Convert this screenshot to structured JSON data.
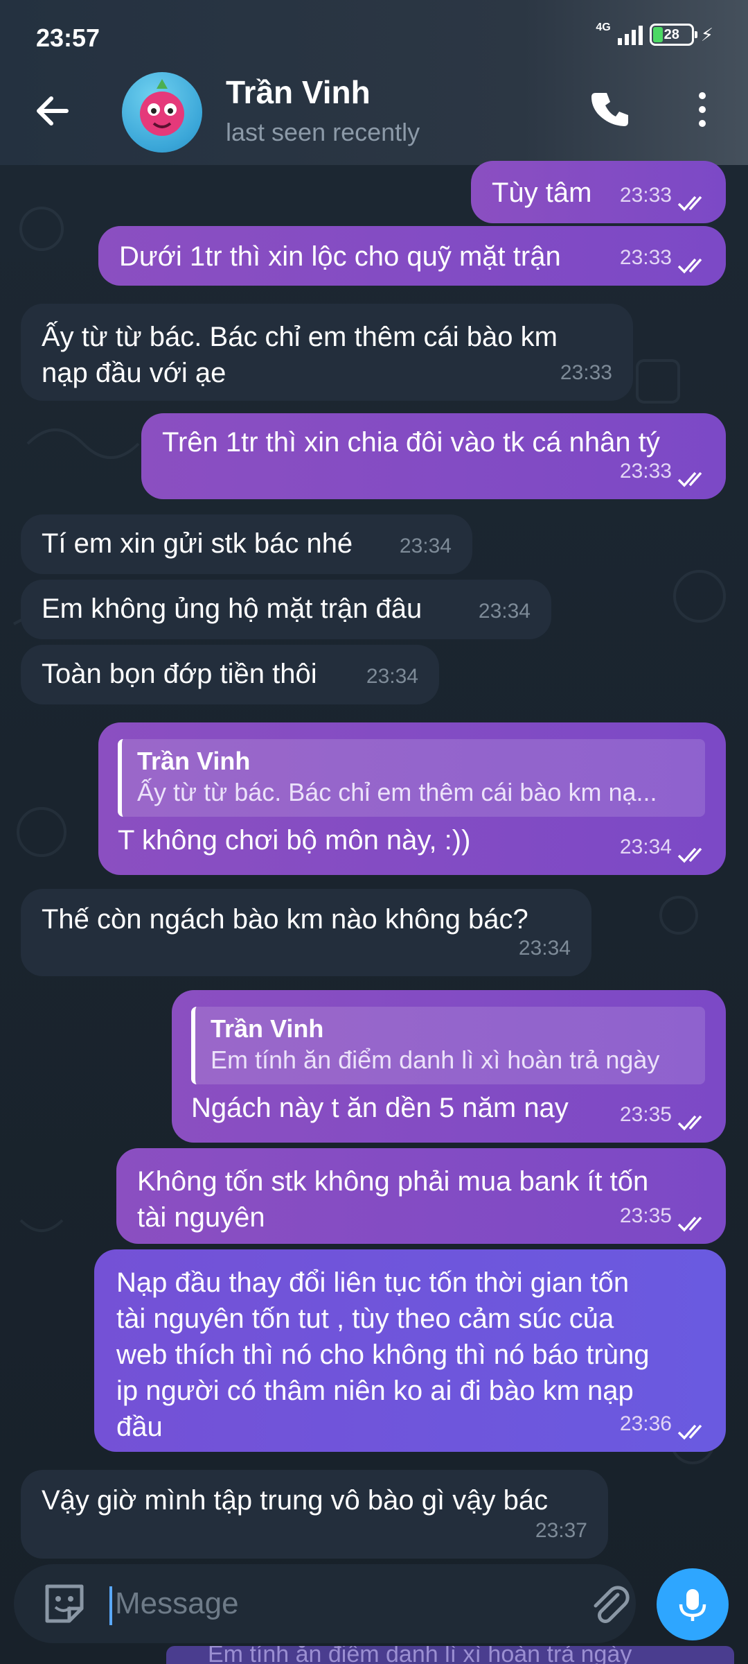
{
  "status_bar": {
    "time": "23:57",
    "network": "4G",
    "battery": "28"
  },
  "header": {
    "title": "Trần Vinh",
    "subtitle": "last seen recently"
  },
  "messages": [
    {
      "dir": "out",
      "text": "Tùy tâm",
      "time": "23:33"
    },
    {
      "dir": "out",
      "text": "Dưới 1tr thì xin lộc cho quỹ mặt trận",
      "time": "23:33"
    },
    {
      "dir": "in",
      "line1": "Ấy từ từ bác. Bác chỉ em thêm cái bào km",
      "line2": "nạp đầu với ạe",
      "time": "23:33"
    },
    {
      "dir": "out",
      "text": "Trên 1tr thì xin chia đôi vào tk cá nhân tý",
      "time": "23:33"
    },
    {
      "dir": "in",
      "text": "Tí em xin gửi stk bác nhé",
      "time": "23:34"
    },
    {
      "dir": "in",
      "text": "Em không ủng hộ mặt trận đâu",
      "time": "23:34"
    },
    {
      "dir": "in",
      "text": "Toàn bọn đớp tiền thôi",
      "time": "23:34"
    },
    {
      "dir": "out",
      "reply_name": "Trần Vinh",
      "reply_text": "Ấy từ từ bác. Bác chỉ em thêm cái bào km nạ...",
      "text": "T không chơi bộ môn này, :))",
      "time": "23:34"
    },
    {
      "dir": "in",
      "text": "Thế còn ngách bào km nào không bác?",
      "time": "23:34"
    },
    {
      "dir": "out",
      "reply_name": "Trần Vinh",
      "reply_text": "Em tính ăn điểm danh lì xì hoàn trả ngày",
      "text": "Ngách này t ăn dền 5 năm nay",
      "time": "23:35"
    },
    {
      "dir": "out",
      "line1": "Không tốn stk không phải mua bank ít tốn",
      "line2": "tài nguyên",
      "time": "23:35"
    },
    {
      "dir": "out",
      "line1": "Nạp đầu thay đổi liên tục tốn thời gian tốn",
      "line2": "tài nguyên tốn tut , tùy theo cảm súc của",
      "line3": "web thích thì nó cho không thì nó báo trùng",
      "line4": "ip người có thâm niên ko ai đi bào km nạp",
      "line5": "đầu",
      "time": "23:36"
    },
    {
      "dir": "in",
      "text": "Vậy giờ mình tập trung vô bào gì vậy bác",
      "time": "23:37"
    }
  ],
  "input": {
    "placeholder": "Message"
  },
  "bottom_strip_text": "Em tính ăn điểm danh lì xì hoàn trả ngày",
  "icons": {
    "back": "arrow-left-icon",
    "call": "phone-icon",
    "more": "more-vertical-icon",
    "sticker": "sticker-icon",
    "attach": "paperclip-icon",
    "mic": "microphone-icon",
    "read": "double-check-icon"
  },
  "colors": {
    "accent": "#2ea6ff",
    "incoming_bubble": "#232e3c",
    "outgoing_bubble": "#7c49c6",
    "background": "#17212b"
  }
}
